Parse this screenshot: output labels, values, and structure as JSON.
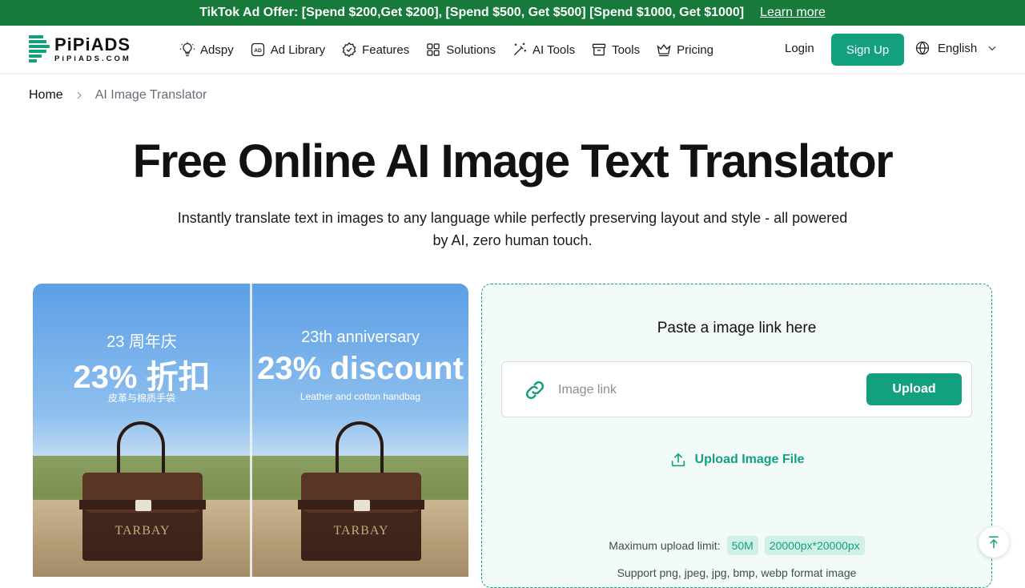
{
  "promo": {
    "text": "TikTok Ad Offer: [Spend $200,Get $200], [Spend $500, Get $500] [Spend $1000, Get $1000]",
    "link": "Learn more"
  },
  "logo": {
    "name": "PiPiADS",
    "domain": "PiPiADS.COM"
  },
  "nav": {
    "items": [
      {
        "label": "Adspy",
        "icon": "lightbulb-icon"
      },
      {
        "label": "Ad Library",
        "icon": "ad-icon"
      },
      {
        "label": "Features",
        "icon": "badge-check-icon"
      },
      {
        "label": "Solutions",
        "icon": "grid-icon"
      },
      {
        "label": "AI Tools",
        "icon": "magic-wand-icon"
      },
      {
        "label": "Tools",
        "icon": "archive-icon"
      },
      {
        "label": "Pricing",
        "icon": "crown-icon"
      }
    ],
    "login": "Login",
    "signup": "Sign Up",
    "language": "English"
  },
  "breadcrumb": {
    "home": "Home",
    "current": "AI Image Translator"
  },
  "hero": {
    "title": "Free Online AI Image Text Translator",
    "subtitle": "Instantly translate text in images to any language while perfectly preserving layout and style - all powered by AI, zero human touch."
  },
  "preview": {
    "original": {
      "line1": "23 周年庆",
      "line2": "23% 折扣",
      "line3": "皮革与棉质手袋"
    },
    "translated": {
      "line1": "23th anniversary",
      "line2": "23% discount",
      "line3": "Leather and cotton handbag"
    },
    "brand": "TARBAY"
  },
  "uploader": {
    "title": "Paste a image link here",
    "placeholder": "Image link",
    "upload_button": "Upload",
    "upload_file": "Upload Image File",
    "limit_label": "Maximum upload limit:",
    "limit_size": "50M",
    "limit_dims": "20000px*20000px",
    "formats": "Support png, jpeg, jpg, bmp, webp format image"
  },
  "colors": {
    "brand": "#13a07f",
    "promo_bg": "#177a3a"
  }
}
